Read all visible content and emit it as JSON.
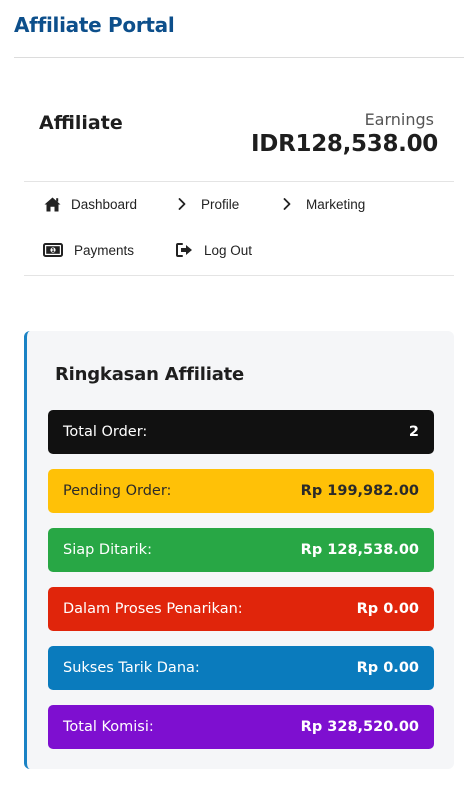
{
  "header": {
    "title": "Affiliate Portal"
  },
  "profile": {
    "name": "Affiliate",
    "earnings_label": "Earnings",
    "earnings_value": "IDR128,538.00"
  },
  "nav": {
    "items": [
      {
        "label": "Dashboard",
        "icon": "home-icon"
      },
      {
        "label": "Profile",
        "icon": "chevron-right-icon"
      },
      {
        "label": "Marketing",
        "icon": "chevron-right-icon"
      },
      {
        "label": "Payments",
        "icon": "money-icon"
      },
      {
        "label": "Log Out",
        "icon": "logout-icon"
      }
    ]
  },
  "summary": {
    "title": "Ringkasan Affiliate",
    "rows": [
      {
        "label": "Total Order:",
        "value": "2",
        "color": "#111111"
      },
      {
        "label": "Pending Order:",
        "value": "Rp 199,982.00",
        "color": "#ffc107"
      },
      {
        "label": "Siap Ditarik:",
        "value": "Rp 128,538.00",
        "color": "#28a745"
      },
      {
        "label": "Dalam Proses Penarikan:",
        "value": "Rp 0.00",
        "color": "#e0250b"
      },
      {
        "label": "Sukses Tarik Dana:",
        "value": "Rp 0.00",
        "color": "#0a7bbd"
      },
      {
        "label": "Total Komisi:",
        "value": "Rp 328,520.00",
        "color": "#7e0fd0"
      }
    ]
  }
}
